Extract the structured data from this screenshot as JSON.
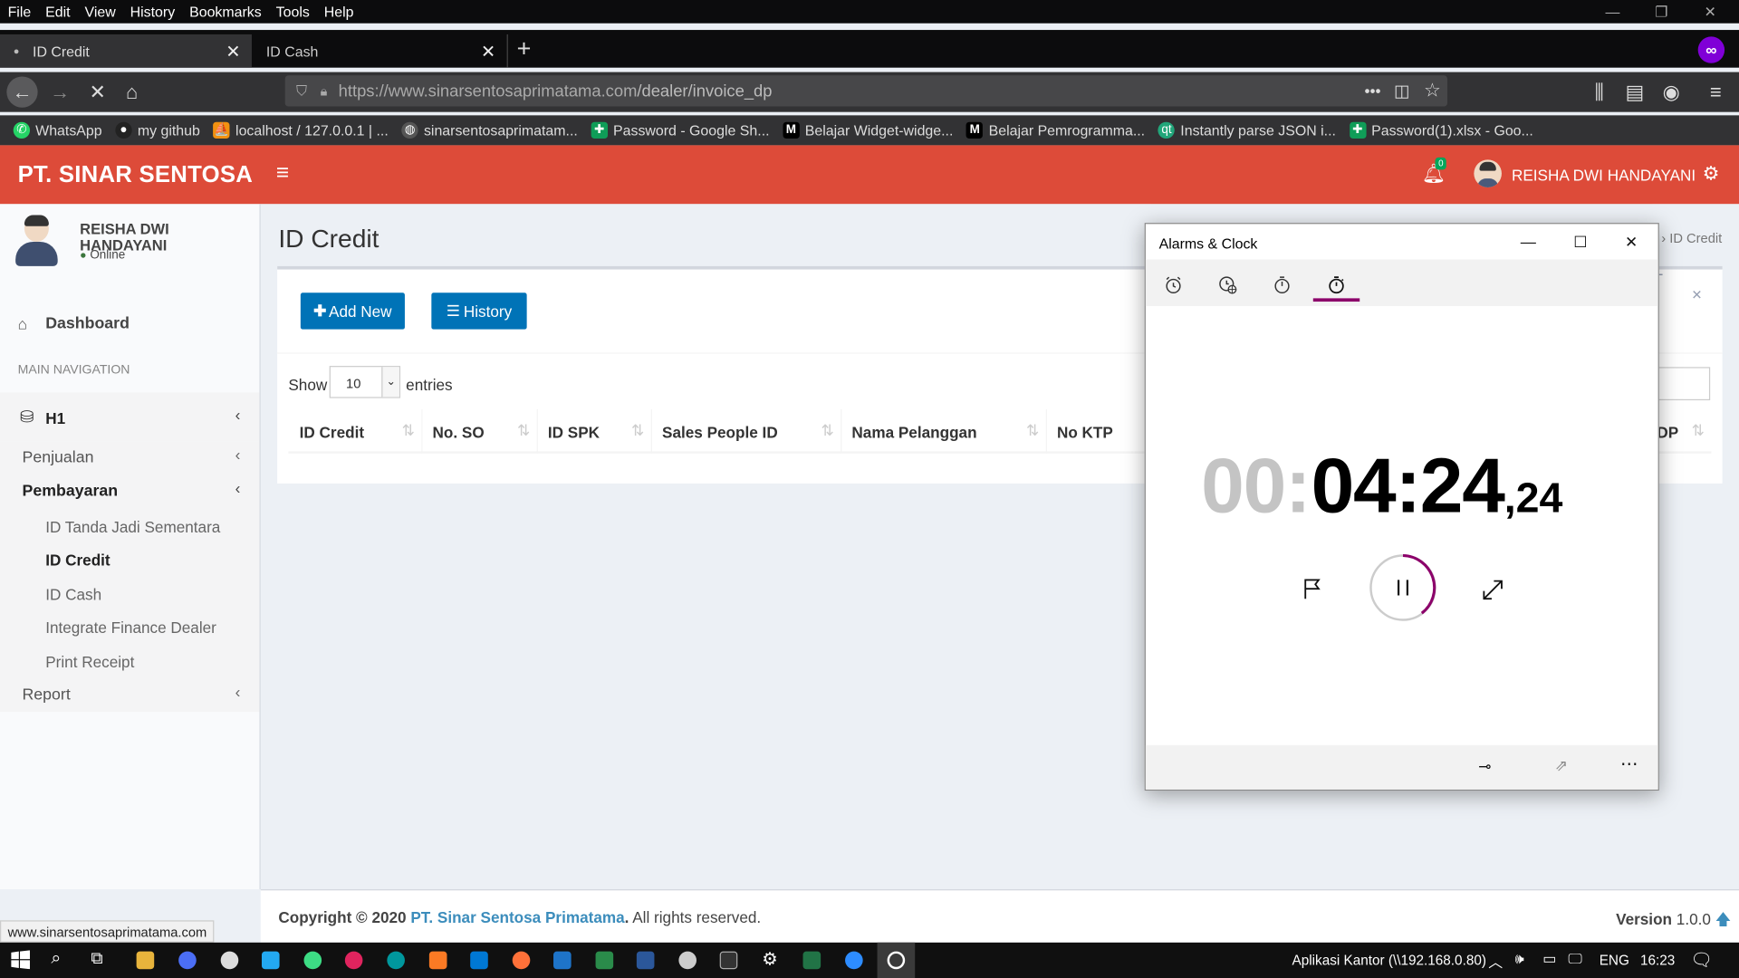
{
  "browser": {
    "menu": [
      "File",
      "Edit",
      "View",
      "History",
      "Bookmarks",
      "Tools",
      "Help"
    ],
    "tabs": [
      {
        "label": "ID Credit"
      },
      {
        "label": "ID Cash"
      }
    ],
    "url": "https://www.sinarsentosaprimatama.com/dealer/invoice_dp",
    "url_host": "https://www.sinarsentosaprimatama.com",
    "url_path": "/dealer/invoice_dp",
    "url_dots": "•••",
    "bookmarks": [
      "WhatsApp",
      "my github",
      "localhost / 127.0.0.1 | ...",
      "sinarsentosaprimatam...",
      "Password - Google Sh...",
      "Belajar Widget-widge...",
      "Belajar Pemrogramma...",
      "Instantly parse JSON i...",
      "Password(1).xlsx - Goo..."
    ],
    "status_url": "www.sinarsentosaprimatama.com"
  },
  "app": {
    "brand": "PT. SINAR SENTOSA",
    "notification_count": "0",
    "user_name": "REISHA DWI HANDAYANI",
    "user_status": "Online",
    "accent_color": "#dd4b39"
  },
  "sidebar": {
    "dashboard": "Dashboard",
    "section_header": "MAIN NAVIGATION",
    "group": "H1",
    "items": [
      {
        "label": "Penjualan"
      },
      {
        "label": "Pembayaran"
      },
      {
        "label": "ID Tanda Jadi Sementara"
      },
      {
        "label": "ID Credit"
      },
      {
        "label": "ID Cash"
      },
      {
        "label": "Integrate Finance Dealer"
      },
      {
        "label": "Print Receipt"
      },
      {
        "label": "Report"
      }
    ]
  },
  "main": {
    "page_title": "ID Credit",
    "breadcrumb_current": "ID Credit",
    "add_new_label": "Add New",
    "history_label": "History",
    "show_label": "Show",
    "entries_value": "10",
    "entries_label": "entries",
    "columns": [
      "ID Credit",
      "No. SO",
      "ID SPK",
      "Sales People ID",
      "Nama Pelanggan",
      "No KTP",
      "DP"
    ]
  },
  "footer": {
    "copyright_prefix": "Copyright © 2020",
    "company": "PT. Sinar Sentosa Primatama",
    "rights": "All rights reserved.",
    "version_label": "Version",
    "version_number": "1.0.0"
  },
  "alarm_window": {
    "title": "Alarms & Clock",
    "time_hours": "00",
    "time_sep": ":",
    "time_main": "04:24",
    "time_fraction": ",24"
  },
  "taskbar": {
    "network_label": "Aplikasi Kantor (\\\\192.168.0.80)",
    "language": "ENG",
    "time": "16:23"
  }
}
